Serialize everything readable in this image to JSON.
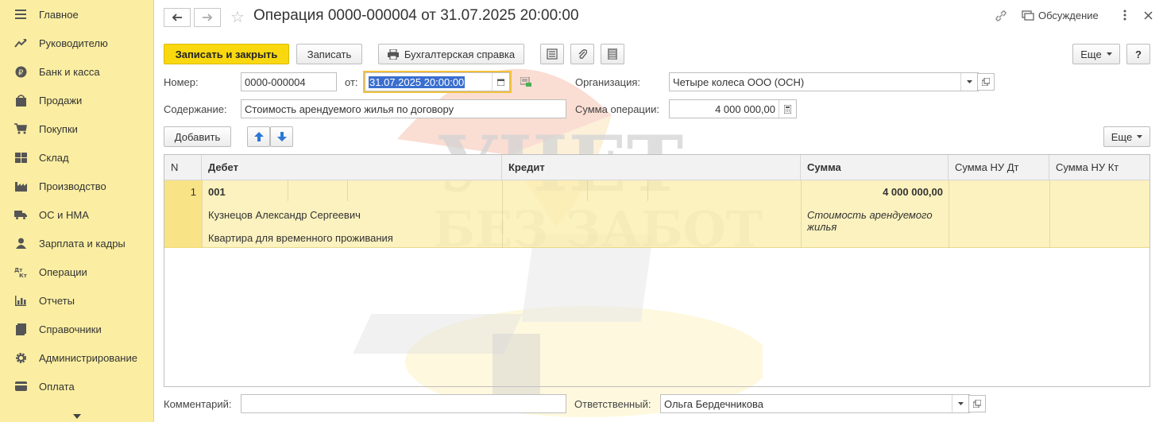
{
  "sidebar": {
    "items": [
      {
        "label": "Главное",
        "icon": "menu-icon"
      },
      {
        "label": "Руководителю",
        "icon": "trend-icon"
      },
      {
        "label": "Банк и касса",
        "icon": "ruble-coin-icon"
      },
      {
        "label": "Продажи",
        "icon": "shopping-bag-icon"
      },
      {
        "label": "Покупки",
        "icon": "cart-icon"
      },
      {
        "label": "Склад",
        "icon": "warehouse-icon"
      },
      {
        "label": "Производство",
        "icon": "factory-icon"
      },
      {
        "label": "ОС и НМА",
        "icon": "truck-icon"
      },
      {
        "label": "Зарплата и кадры",
        "icon": "person-icon"
      },
      {
        "label": "Операции",
        "icon": "dt-kt-icon"
      },
      {
        "label": "Отчеты",
        "icon": "bar-chart-icon"
      },
      {
        "label": "Справочники",
        "icon": "book-icon"
      },
      {
        "label": "Администрирование",
        "icon": "gear-icon"
      },
      {
        "label": "Оплата",
        "icon": "card-icon"
      }
    ]
  },
  "header": {
    "title": "Операция 0000-000004 от 31.07.2025 20:00:00",
    "discussion": "Обсуждение"
  },
  "toolbar": {
    "save_close": "Записать и закрыть",
    "save": "Записать",
    "report": "Бухгалтерская справка",
    "more": "Еще",
    "help": "?"
  },
  "form": {
    "number_label": "Номер:",
    "number_value": "0000-000004",
    "date_label": "от:",
    "date_value": "31.07.2025 20:00:00",
    "org_label": "Организация:",
    "org_value": "Четыре колеса ООО (ОСН)",
    "content_label": "Содержание:",
    "content_value": "Стоимость арендуемого жилья по договору",
    "sum_label": "Сумма операции:",
    "sum_value": "4 000 000,00"
  },
  "table_toolbar": {
    "add": "Добавить",
    "more": "Еще"
  },
  "table": {
    "columns": [
      "N",
      "Дебет",
      "Кредит",
      "Сумма",
      "Сумма НУ Дт",
      "Сумма НУ Кт"
    ],
    "rows": [
      {
        "n": "1",
        "debit_account": "001",
        "debit_sub1": "Кузнецов Александр Сергеевич",
        "debit_sub2": "Квартира для временного проживания",
        "credit": "",
        "sum": "4 000 000,00",
        "sum_note_1": "Стоимость арендуемого",
        "sum_note_2": "жилья"
      }
    ]
  },
  "footer": {
    "comment_label": "Комментарий:",
    "comment_value": "",
    "responsible_label": "Ответственный:",
    "responsible_value": "Ольга Бердечникова"
  },
  "watermark": {
    "line1": "УЧЕТ",
    "line2": "БЕЗ ЗАБОТ"
  },
  "colors": {
    "sidebar_bg": "#fbeea2",
    "primary_button": "#f9d810",
    "selected_row": "#fbeeaa",
    "selection": "#3a6fcf"
  }
}
